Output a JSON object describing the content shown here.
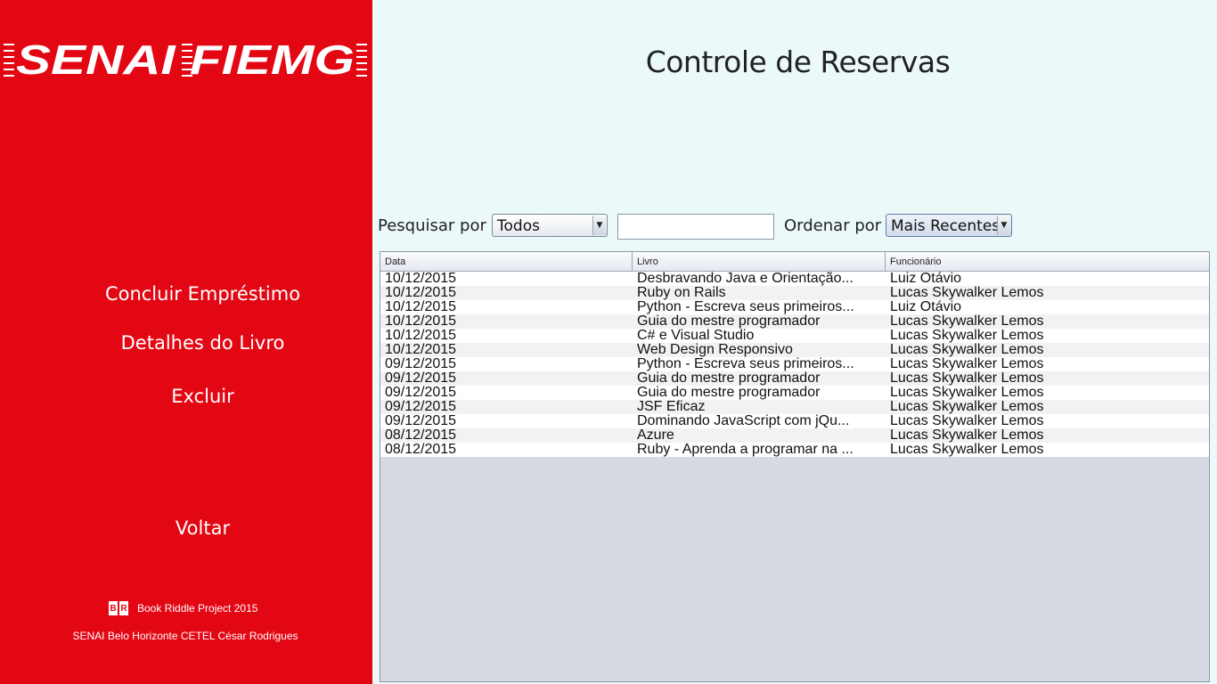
{
  "sidebar": {
    "logo_text": "SENAI FIEMG",
    "nav": [
      {
        "label": "Concluir Empréstimo"
      },
      {
        "label": "Detalhes do Livro"
      },
      {
        "label": "Excluir"
      },
      {
        "label": "Voltar"
      }
    ],
    "footer_logo_letters": [
      "B",
      "R"
    ],
    "footer_project": "Book Riddle Project 2015",
    "footer_credit": "SENAI Belo Horizonte CETEL César Rodrigues"
  },
  "main": {
    "title": "Controle de Reservas",
    "search": {
      "label": "Pesquisar por",
      "filter_value": "Todos",
      "query_value": "",
      "order_label": "Ordenar por",
      "order_value": "Mais Recentes"
    },
    "table": {
      "columns": [
        "Data",
        "Livro",
        "Funcionário"
      ],
      "rows": [
        [
          "10/12/2015",
          "Desbravando Java e Orientação...",
          "Luiz Otávio"
        ],
        [
          "10/12/2015",
          "Ruby on Rails",
          "Lucas Skywalker Lemos"
        ],
        [
          "10/12/2015",
          "Python - Escreva seus primeiros...",
          "Luiz Otávio"
        ],
        [
          "10/12/2015",
          "Guia do mestre programador",
          "Lucas Skywalker Lemos"
        ],
        [
          "10/12/2015",
          "C# e Visual Studio",
          "Lucas Skywalker Lemos"
        ],
        [
          "10/12/2015",
          "Web Design Responsivo",
          "Lucas Skywalker Lemos"
        ],
        [
          "09/12/2015",
          "Python - Escreva seus primeiros...",
          "Lucas Skywalker Lemos"
        ],
        [
          "09/12/2015",
          "Guia do mestre programador",
          "Lucas Skywalker Lemos"
        ],
        [
          "09/12/2015",
          "Guia do mestre programador",
          "Lucas Skywalker Lemos"
        ],
        [
          "09/12/2015",
          "JSF Eficaz",
          "Lucas Skywalker Lemos"
        ],
        [
          "09/12/2015",
          "Dominando JavaScript com jQu...",
          "Lucas Skywalker Lemos"
        ],
        [
          "08/12/2015",
          "Azure",
          "Lucas Skywalker Lemos"
        ],
        [
          "08/12/2015",
          "Ruby - Aprenda a programar na ...",
          "Lucas Skywalker Lemos"
        ]
      ]
    }
  },
  "colors": {
    "sidebar_bg": "#e30613",
    "main_bg": "#ebf9f9",
    "table_empty_bg": "#d6dae2"
  },
  "icons": {
    "dropdown_arrow": "chevron-down-icon"
  }
}
